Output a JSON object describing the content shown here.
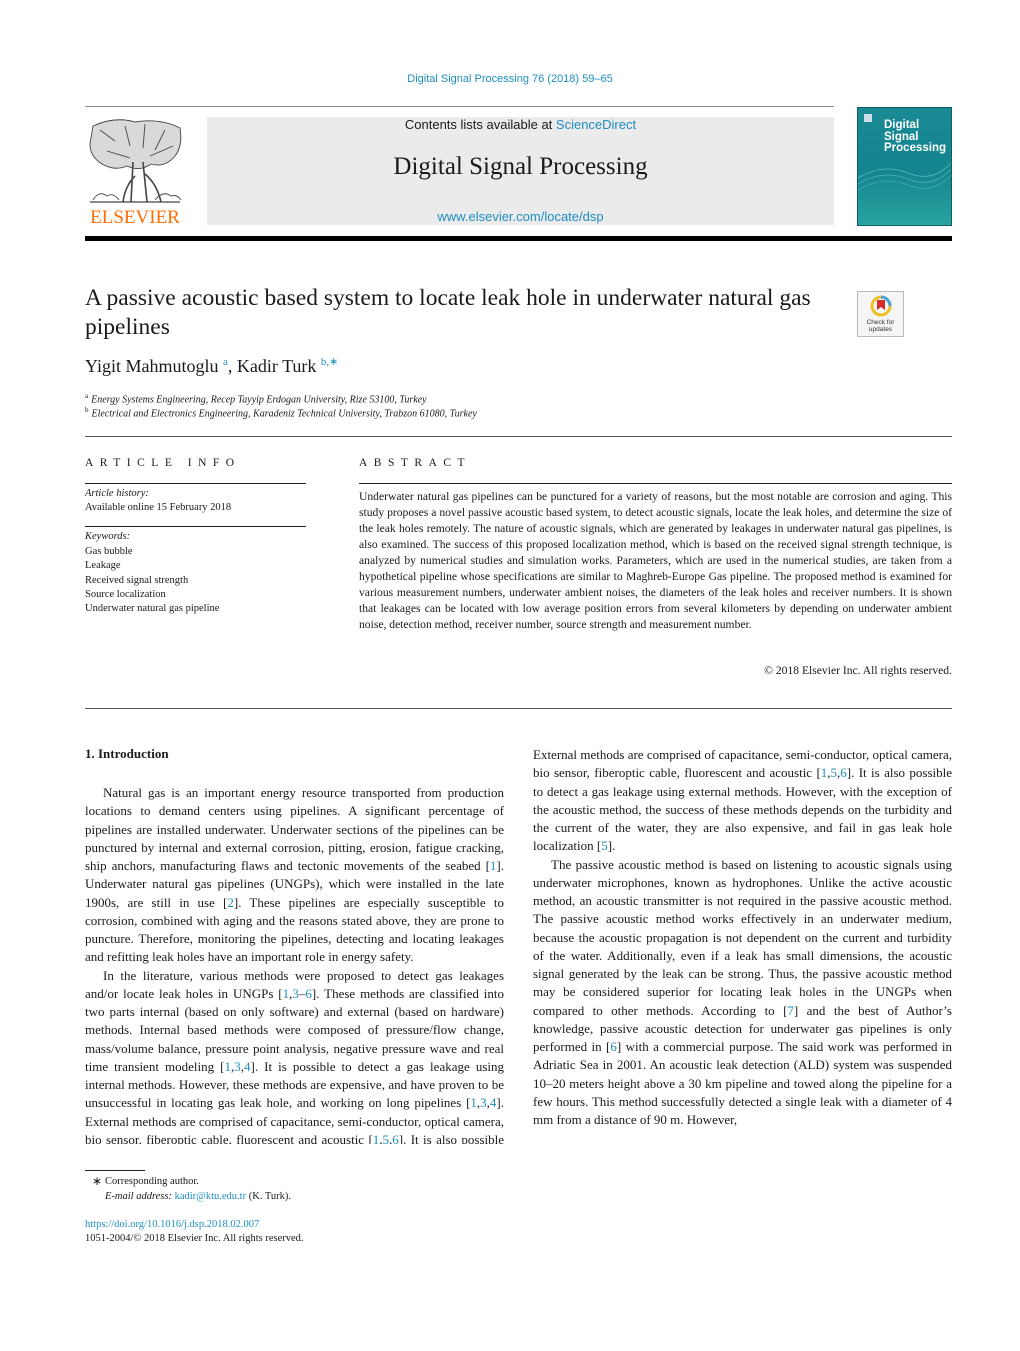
{
  "header": {
    "journal_ref": "Digital Signal Processing 76 (2018) 59–65",
    "contents_prefix": "Contents lists available at ",
    "contents_link": "ScienceDirect",
    "journal_title": "Digital Signal Processing",
    "journal_url": "www.elsevier.com/locate/dsp",
    "publisher_logo_text": "ELSEVIER",
    "cover_title_lines": [
      "Digital",
      "Signal",
      "Processing"
    ],
    "check_updates_label_1": "Check for",
    "check_updates_label_2": "updates",
    "colors": {
      "link": "#1d8ec0",
      "elsevier_orange": "#ff6c00",
      "cover_teal": "#15878f"
    }
  },
  "article": {
    "title": "A passive acoustic based system to locate leak hole in underwater natural gas pipelines",
    "authors": [
      {
        "name": "Yigit Mahmutoglu",
        "sup": "a"
      },
      {
        "name": "Kadir Turk",
        "sup": "b,∗"
      }
    ],
    "affiliations": [
      {
        "mark": "a",
        "text": "Energy Systems Engineering, Recep Tayyip Erdogan University, Rize 53100, Turkey"
      },
      {
        "mark": "b",
        "text": "Electrical and Electronics Engineering, Karadeniz Technical University, Trabzon 61080, Turkey"
      }
    ]
  },
  "article_info": {
    "heading": "ARTICLE INFO",
    "history_label": "Article history:",
    "history_value": "Available online 15 February 2018",
    "keywords_label": "Keywords:",
    "keywords": [
      "Gas bubble",
      "Leakage",
      "Received signal strength",
      "Source localization",
      "Underwater natural gas pipeline"
    ]
  },
  "abstract": {
    "heading": "ABSTRACT",
    "text": "Underwater natural gas pipelines can be punctured for a variety of reasons, but the most notable are corrosion and aging. This study proposes a novel passive acoustic based system, to detect acoustic signals, locate the leak holes, and determine the size of the leak holes remotely. The nature of acoustic signals, which are generated by leakages in underwater natural gas pipelines, is also examined. The success of this proposed localization method, which is based on the received signal strength technique, is analyzed by numerical studies and simulation works. Parameters, which are used in the numerical studies, are taken from a hypothetical pipeline whose specifications are similar to Maghreb-Europe Gas pipeline. The proposed method is examined for various measurement numbers, underwater ambient noises, the diameters of the leak holes and receiver numbers. It is shown that leakages can be located with low average position errors from several kilometers by depending on underwater ambient noise, detection method, receiver number, source strength and measurement number.",
    "copyright": "© 2018 Elsevier Inc. All rights reserved."
  },
  "intro": {
    "heading": "1. Introduction",
    "p1": [
      {
        "t": "Natural gas is an important energy resource transported from production locations to demand centers using pipelines. A significant percentage of pipelines are installed underwater. Underwater sections of the pipelines can be punctured by internal and external corrosion, pitting, erosion, fatigue cracking, ship anchors, manufacturing flaws and tectonic movements of the seabed ["
      },
      {
        "ref": "1"
      },
      {
        "t": "]. Underwater natural gas pipelines (UNGPs), which were installed in the late 1900s, are still in use ["
      },
      {
        "ref": "2"
      },
      {
        "t": "]. These pipelines are especially susceptible to corrosion, combined with aging and the reasons stated above, they are prone to puncture. Therefore, monitoring the pipelines, detecting and locating leakages and refitting leak holes have an important role in energy safety."
      }
    ],
    "p2": [
      {
        "t": "In the literature, various methods were proposed to detect gas leakages and/or locate leak holes in UNGPs ["
      },
      {
        "ref": "1"
      },
      {
        "t": ","
      },
      {
        "ref": "3"
      },
      {
        "t": "–"
      },
      {
        "ref": "6"
      },
      {
        "t": "]. These methods are classified into two parts internal (based on only software) and external (based on hardware) methods. Internal based methods were composed of pressure/flow change, mass/volume balance, pressure point analysis, negative pressure wave and real time transient modeling ["
      },
      {
        "ref": "1"
      },
      {
        "t": ","
      },
      {
        "ref": "3"
      },
      {
        "t": ","
      },
      {
        "ref": "4"
      },
      {
        "t": "]. It is possible to detect a gas leakage using internal methods. However, these methods are expensive, and have proven to be unsuccessful in locating gas leak hole, and working on long pipelines ["
      },
      {
        "ref": "1"
      },
      {
        "t": ","
      },
      {
        "ref": "3"
      },
      {
        "t": ","
      },
      {
        "ref": "4"
      },
      {
        "t": "]. External methods are comprised of capacitance, semi-conductor, optical camera, bio sensor, fiberoptic cable, fluorescent and acoustic ["
      },
      {
        "ref": "1"
      },
      {
        "t": ","
      },
      {
        "ref": "5"
      },
      {
        "t": ","
      },
      {
        "ref": "6"
      },
      {
        "t": "]. It is also possible to detect a gas leakage using external methods. However, with the exception of the acoustic method, the success of these methods depends on the turbidity and the current of the water, they are also expensive, and fail in gas leak hole localization ["
      },
      {
        "ref": "5"
      },
      {
        "t": "]."
      }
    ],
    "p3": [
      {
        "t": "The passive acoustic method is based on listening to acoustic signals using underwater microphones, known as hydrophones. Unlike the active acoustic method, an acoustic transmitter is not required in the passive acoustic method. The passive acoustic method works effectively in an underwater medium, because the acoustic propagation is not dependent on the current and turbidity of the water. Additionally, even if a leak has small dimensions, the acoustic signal generated by the leak can be strong. Thus, the passive acoustic method may be considered superior for locating leak holes in the UNGPs when compared to other methods. According to ["
      },
      {
        "ref": "7"
      },
      {
        "t": "] and the best of Author’s knowledge, passive acoustic detection for underwater gas pipelines is only performed in ["
      },
      {
        "ref": "6"
      },
      {
        "t": "] with a commercial purpose. The said work was performed in Adriatic Sea in 2001. An acoustic leak detection (ALD) system was suspended 10–20 meters height above a 30 km pipeline and towed along the pipeline for a few hours. This method successfully detected a single leak with a diameter of 4 mm from a distance of 90 m. However,"
      }
    ]
  },
  "footnotes": {
    "star": "∗",
    "corresponding": "Corresponding author.",
    "email_label": "E-mail address: ",
    "email": "kadir@ktu.edu.tr",
    "email_suffix": " (K. Turk).",
    "doi": "https://doi.org/10.1016/j.dsp.2018.02.007",
    "issn": "1051-2004/© 2018 Elsevier Inc. All rights reserved."
  }
}
